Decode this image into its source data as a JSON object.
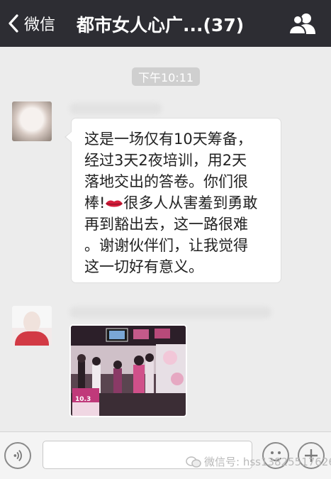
{
  "header": {
    "back_label": "微信",
    "title": "都市女人心广...(37)",
    "back_icon": "chevron-left-icon",
    "group_icon": "group-members-icon"
  },
  "timestamp": "下午10:11",
  "message1": {
    "lines": [
      "这是一场仅有10天筹备，",
      "经过3天2夜培训，用2天",
      "落地交出的答卷。你们很",
      "棒!",
      "很多人从害羞到勇敢",
      "再到豁出去，这一路很难",
      "。谢谢伙伴们，让我觉得",
      "这一切好有意义。"
    ],
    "emoji": "lips-emoji"
  },
  "photo_sign": "10.3",
  "bottom": {
    "input_placeholder": "",
    "watermark": "微信号: hss13825517626"
  }
}
